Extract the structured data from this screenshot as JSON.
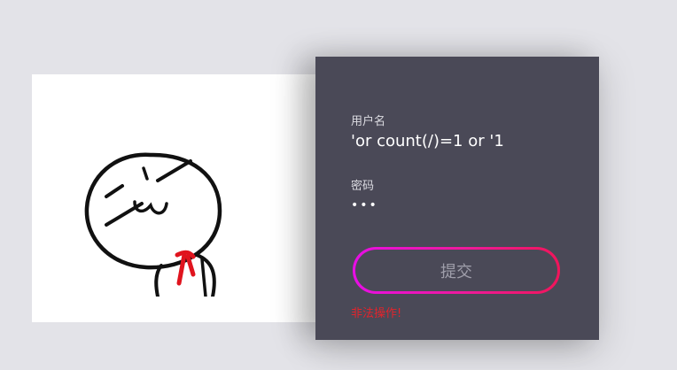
{
  "login_form": {
    "username_label": "用户名",
    "username_value": "'or count(/)=1 or '1",
    "password_label": "密码",
    "password_value": "•••",
    "submit_label": "提交",
    "error_message": "非法操作!"
  },
  "colors": {
    "panel_background": "#4a4957",
    "submit_gradient_start": "#e80ee6",
    "submit_gradient_end": "#f0155a",
    "error_text": "#e2242c"
  },
  "illustration": {
    "icon": "stick-figure-smug-face-icon"
  }
}
